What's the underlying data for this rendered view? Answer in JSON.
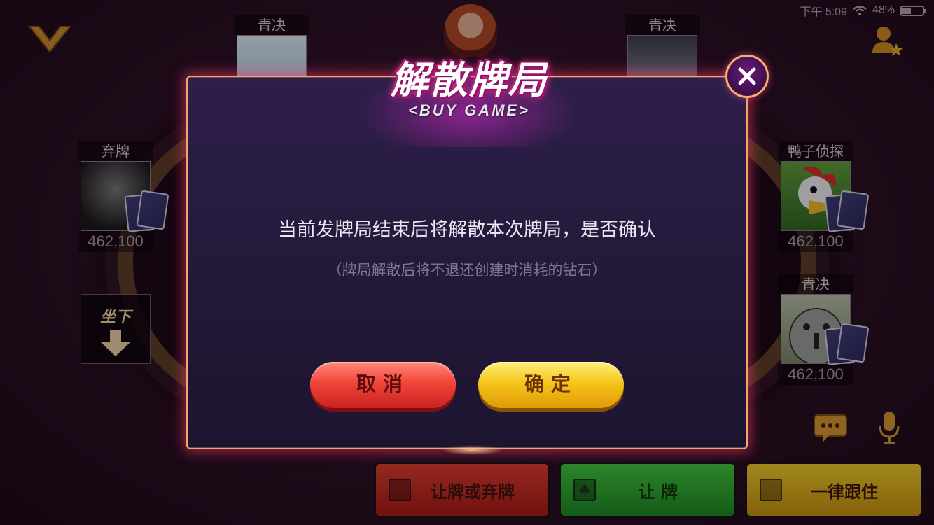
{
  "status_bar": {
    "time": "下午 5:09",
    "battery": "48%",
    "battery_level": 0.48
  },
  "seats": {
    "top_left": {
      "name": "青决"
    },
    "top_right": {
      "name": "青决"
    },
    "left": {
      "name": "弃牌",
      "chips": "462,100"
    },
    "right_top": {
      "name": "鸭子侦探",
      "chips": "462,100"
    },
    "right_bottom": {
      "name": "青决",
      "chips": "462,100"
    }
  },
  "sit_down_label": "坐下",
  "dialog": {
    "title": "解散牌局",
    "subtitle": "<BUY GAME>",
    "message": "当前发牌局结束后将解散本次牌局，是否确认",
    "note": "（牌局解散后将不退还创建时消耗的钻石）",
    "cancel_label": "取消",
    "confirm_label": "确定"
  },
  "action_bar": {
    "check_or_fold": "让牌或弃牌",
    "check": "让 牌",
    "call_any": "一律跟住"
  },
  "colors": {
    "modal_border": "#f3a66a",
    "cancel_red": "#f2453a",
    "confirm_yellow": "#f6c51a",
    "action_red": "#c0281c",
    "action_green": "#22a32a",
    "action_yellow": "#e0b010"
  }
}
